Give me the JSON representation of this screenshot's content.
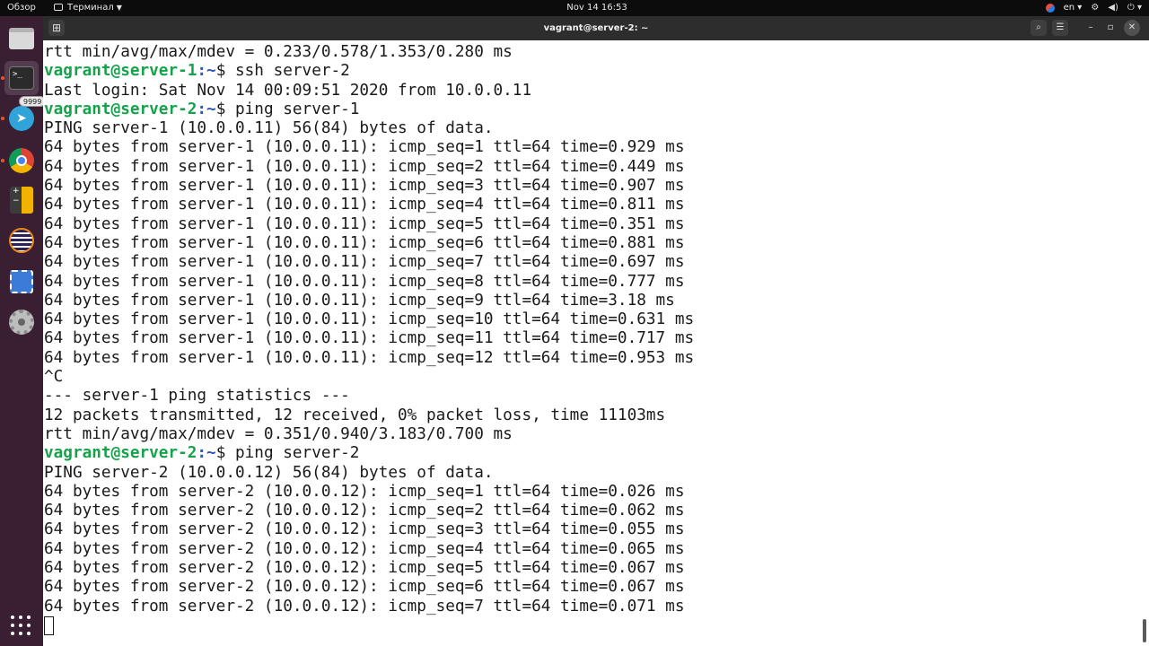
{
  "topbar": {
    "overview": "Обзор",
    "app_name": "Терминал",
    "clock": "Nov 14  16:53",
    "lang": "en",
    "icons": [
      "chrome-indicator-icon",
      "network-icon",
      "volume-icon",
      "power-icon"
    ]
  },
  "dock": {
    "items": [
      "files-icon",
      "terminal-icon",
      "telegram-icon",
      "chrome-icon",
      "calculator-icon",
      "eclipse-icon",
      "screenshot-icon",
      "settings-icon",
      "app-grid-icon"
    ],
    "telegram_badge": "9999"
  },
  "window": {
    "title": "vagrant@server-2: ~",
    "new_tab": "⊞",
    "search": "⌕",
    "menu": "☰",
    "minimize": "–",
    "maximize": "▫",
    "close": "✕"
  },
  "terminal": {
    "line1": "rtt min/avg/max/mdev = 0.233/0.578/1.353/0.280 ms",
    "p1_user": "vagrant@server-1",
    "p1_path": ":~",
    "p1_cmd": "$ ssh server-2",
    "line3": "Last login: Sat Nov 14 00:09:51 2020 from 10.0.0.11",
    "p2_user": "vagrant@server-2",
    "p2_path": ":~",
    "p2_cmd": "$ ping server-1",
    "ping1_header": "PING server-1 (10.0.0.11) 56(84) bytes of data.",
    "ping1": [
      "64 bytes from server-1 (10.0.0.11): icmp_seq=1 ttl=64 time=0.929 ms",
      "64 bytes from server-1 (10.0.0.11): icmp_seq=2 ttl=64 time=0.449 ms",
      "64 bytes from server-1 (10.0.0.11): icmp_seq=3 ttl=64 time=0.907 ms",
      "64 bytes from server-1 (10.0.0.11): icmp_seq=4 ttl=64 time=0.811 ms",
      "64 bytes from server-1 (10.0.0.11): icmp_seq=5 ttl=64 time=0.351 ms",
      "64 bytes from server-1 (10.0.0.11): icmp_seq=6 ttl=64 time=0.881 ms",
      "64 bytes from server-1 (10.0.0.11): icmp_seq=7 ttl=64 time=0.697 ms",
      "64 bytes from server-1 (10.0.0.11): icmp_seq=8 ttl=64 time=0.777 ms",
      "64 bytes from server-1 (10.0.0.11): icmp_seq=9 ttl=64 time=3.18 ms",
      "64 bytes from server-1 (10.0.0.11): icmp_seq=10 ttl=64 time=0.631 ms",
      "64 bytes from server-1 (10.0.0.11): icmp_seq=11 ttl=64 time=0.717 ms",
      "64 bytes from server-1 (10.0.0.11): icmp_seq=12 ttl=64 time=0.953 ms"
    ],
    "interrupt": "^C",
    "stats_header": "--- server-1 ping statistics ---",
    "stats_packets": "12 packets transmitted, 12 received, 0% packet loss, time 11103ms",
    "stats_rtt": "rtt min/avg/max/mdev = 0.351/0.940/3.183/0.700 ms",
    "p3_user": "vagrant@server-2",
    "p3_path": ":~",
    "p3_cmd": "$ ping server-2",
    "ping2_header": "PING server-2 (10.0.0.12) 56(84) bytes of data.",
    "ping2": [
      "64 bytes from server-2 (10.0.0.12): icmp_seq=1 ttl=64 time=0.026 ms",
      "64 bytes from server-2 (10.0.0.12): icmp_seq=2 ttl=64 time=0.062 ms",
      "64 bytes from server-2 (10.0.0.12): icmp_seq=3 ttl=64 time=0.055 ms",
      "64 bytes from server-2 (10.0.0.12): icmp_seq=4 ttl=64 time=0.065 ms",
      "64 bytes from server-2 (10.0.0.12): icmp_seq=5 ttl=64 time=0.067 ms",
      "64 bytes from server-2 (10.0.0.12): icmp_seq=6 ttl=64 time=0.067 ms",
      "64 bytes from server-2 (10.0.0.12): icmp_seq=7 ttl=64 time=0.071 ms"
    ]
  }
}
